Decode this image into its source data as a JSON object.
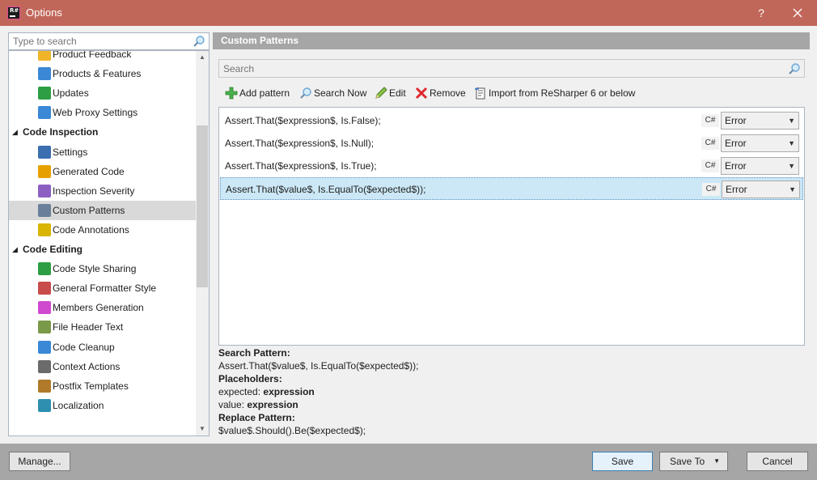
{
  "window": {
    "title": "Options",
    "app_icon_text": "R#",
    "help_glyph": "?",
    "close_glyph": "✕"
  },
  "left": {
    "search_placeholder": "Type to search",
    "tree": [
      {
        "type": "item",
        "label": "Product Feedback",
        "icon": "envelope-icon"
      },
      {
        "type": "item",
        "label": "Products & Features",
        "icon": "puzzle-icon"
      },
      {
        "type": "item",
        "label": "Updates",
        "icon": "download-icon"
      },
      {
        "type": "item",
        "label": "Web Proxy Settings",
        "icon": "globe-icon"
      },
      {
        "type": "group",
        "label": "Code Inspection",
        "expanded": true
      },
      {
        "type": "item",
        "label": "Settings",
        "icon": "inspector-icon"
      },
      {
        "type": "item",
        "label": "Generated Code",
        "icon": "gear-code-icon"
      },
      {
        "type": "item",
        "label": "Inspection Severity",
        "icon": "severity-icon"
      },
      {
        "type": "item",
        "label": "Custom Patterns",
        "icon": "patterns-icon",
        "selected": true
      },
      {
        "type": "item",
        "label": "Code Annotations",
        "icon": "annotation-icon"
      },
      {
        "type": "group",
        "label": "Code Editing",
        "expanded": true
      },
      {
        "type": "item",
        "label": "Code Style Sharing",
        "icon": "style-share-icon"
      },
      {
        "type": "item",
        "label": "General Formatter Style",
        "icon": "formatter-icon"
      },
      {
        "type": "item",
        "label": "Members Generation",
        "icon": "members-icon"
      },
      {
        "type": "item",
        "label": "File Header Text",
        "icon": "file-header-icon"
      },
      {
        "type": "item",
        "label": "Code Cleanup",
        "icon": "broom-icon"
      },
      {
        "type": "item",
        "label": "Context Actions",
        "icon": "hammer-icon"
      },
      {
        "type": "item",
        "label": "Postfix Templates",
        "icon": "template-icon"
      },
      {
        "type": "item",
        "label": "Localization",
        "icon": "bottle-icon"
      }
    ]
  },
  "right": {
    "header": "Custom Patterns",
    "search_placeholder": "Search",
    "toolbar": {
      "add": "Add pattern",
      "search_now": "Search Now",
      "edit": "Edit",
      "remove": "Remove",
      "import": "Import from ReSharper 6 or below"
    },
    "patterns": [
      {
        "text": "Assert.That($expression$, Is.False);",
        "lang": "C#",
        "severity": "Error"
      },
      {
        "text": "Assert.That($expression$, Is.Null);",
        "lang": "C#",
        "severity": "Error"
      },
      {
        "text": "Assert.That($expression$, Is.True);",
        "lang": "C#",
        "severity": "Error"
      },
      {
        "text": "Assert.That($value$, Is.EqualTo($expected$));",
        "lang": "C#",
        "severity": "Error",
        "selected": true
      }
    ],
    "details": {
      "search_pattern_label": "Search Pattern:",
      "search_pattern": "Assert.That($value$, Is.EqualTo($expected$));",
      "placeholders_label": "Placeholders:",
      "placeholders": [
        {
          "name": "expected:",
          "kind": "expression"
        },
        {
          "name": "value:",
          "kind": "expression"
        }
      ],
      "replace_pattern_label": "Replace Pattern:",
      "replace_pattern": "$value$.Should().Be($expected$);"
    }
  },
  "footer": {
    "manage": "Manage...",
    "save": "Save",
    "save_to": "Save To",
    "cancel": "Cancel"
  },
  "colors": {
    "titlebar": "#c1675a",
    "footer": "#a6a6a6",
    "selection": "#cce8f6"
  }
}
